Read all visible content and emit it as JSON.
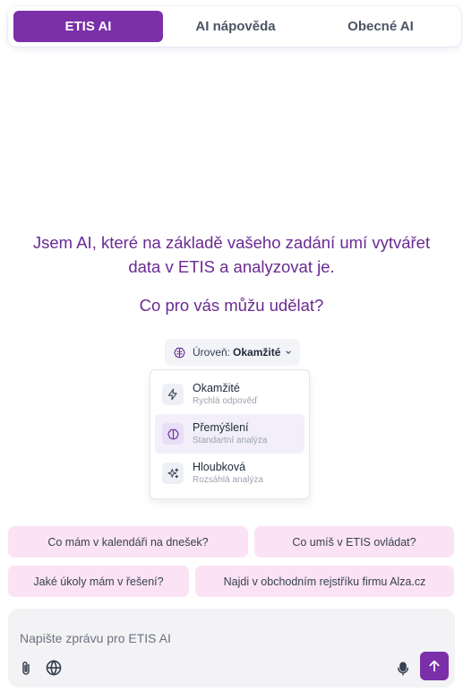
{
  "tabs": [
    {
      "label": "ETIS AI",
      "active": true
    },
    {
      "label": "AI nápověda",
      "active": false
    },
    {
      "label": "Obecné AI",
      "active": false
    }
  ],
  "intro": {
    "line1": "Jsem AI, které na základě vašeho zadání umí vytvářet",
    "line2": "data v ETIS a analyzovat je.",
    "question": "Co pro vás můžu udělat?"
  },
  "level": {
    "prefix": "Úroveň:",
    "value": "Okamžité",
    "icon": "brain-icon"
  },
  "levels": [
    {
      "name": "Okamžité",
      "desc": "Rychlá odpověď",
      "icon": "lightning-icon",
      "highlighted": false
    },
    {
      "name": "Přemýšlení",
      "desc": "Standartní analýza",
      "icon": "brain-icon",
      "highlighted": true
    },
    {
      "name": "Hloubková",
      "desc": "Rozsáhlá analýza",
      "icon": "sparkles-icon",
      "highlighted": false
    }
  ],
  "suggestions": [
    "Co mám v kalendáři na dnešek?",
    "Co umíš v ETIS ovládat?",
    "Jaké úkoly mám v řešení?",
    "Najdi v obchodním rejstříku firmu Alza.cz"
  ],
  "composer": {
    "placeholder": "Napište zprávu pro ETIS AI"
  },
  "colors": {
    "accent": "#7b2fa8",
    "intro_text": "#6a2a92",
    "chip_bg": "#fbe3f5"
  }
}
